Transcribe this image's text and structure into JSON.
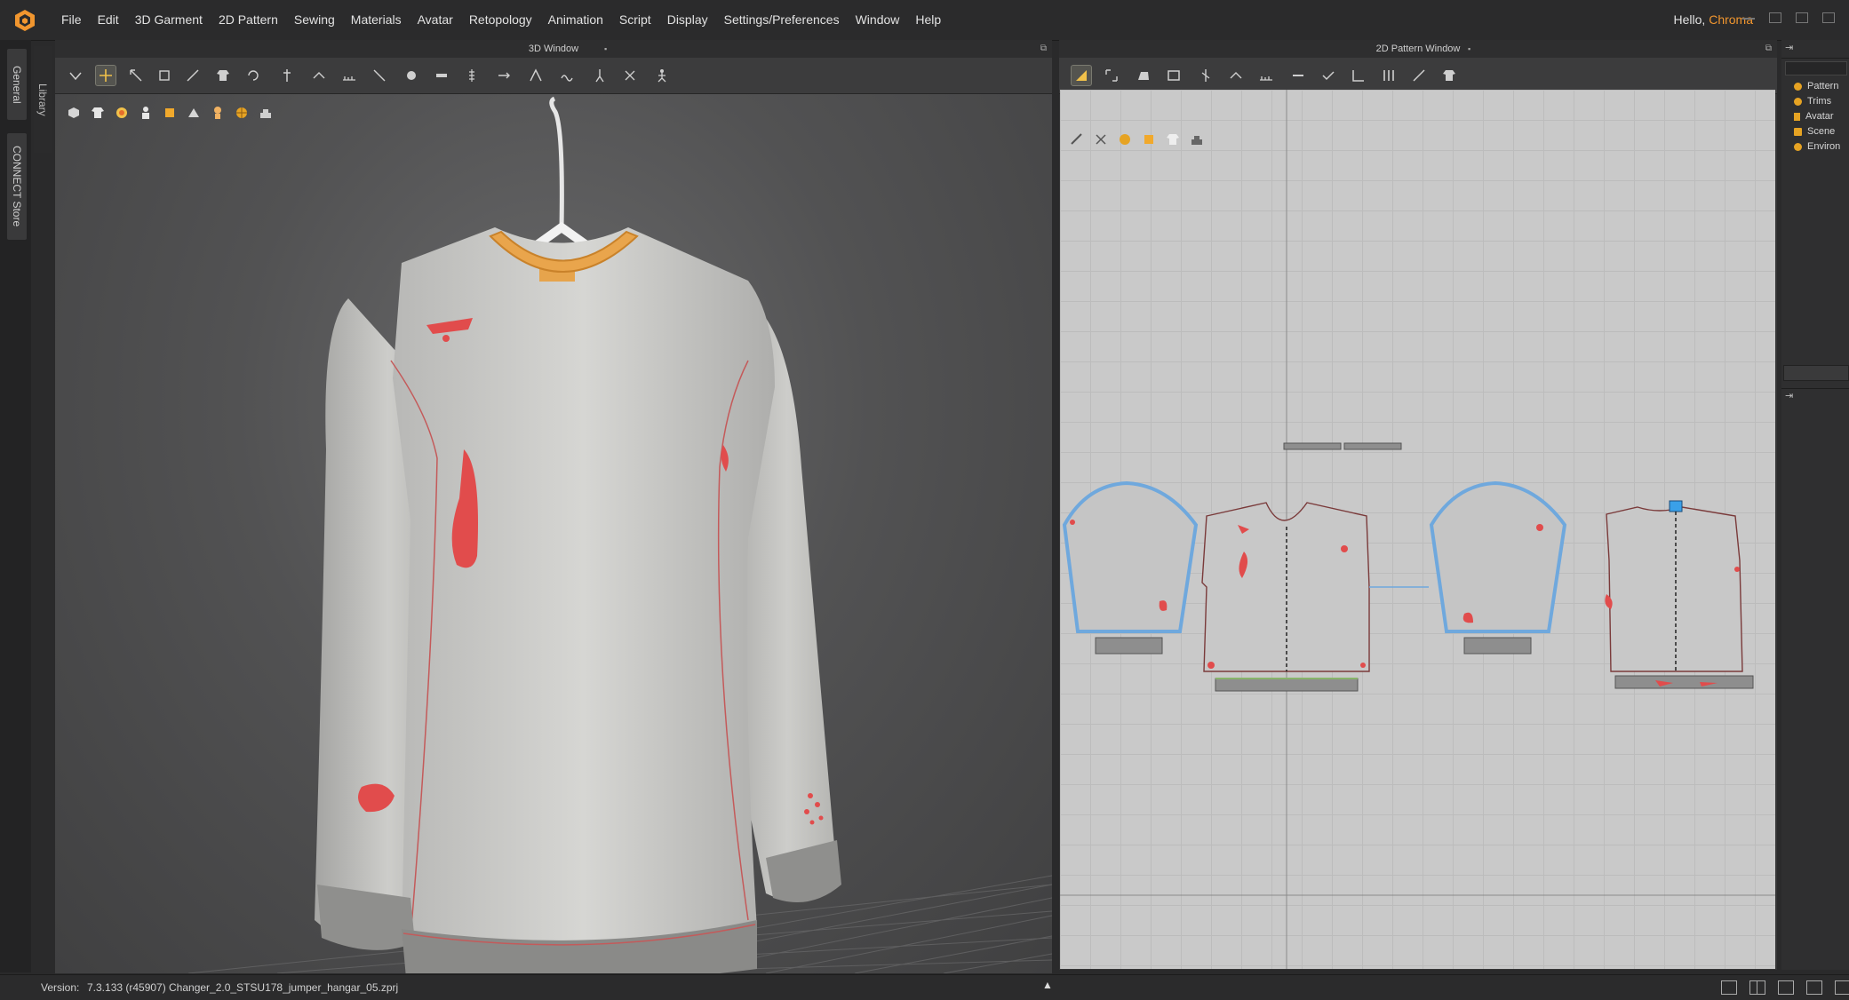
{
  "app": {
    "menu": [
      "File",
      "Edit",
      "3D Garment",
      "2D Pattern",
      "Sewing",
      "Materials",
      "Avatar",
      "Retopology",
      "Animation",
      "Script",
      "Display",
      "Settings/Preferences",
      "Window",
      "Help"
    ],
    "greeting": "Hello,",
    "user_name": "Chroma",
    "accent_color": "#f1962f"
  },
  "side_tabs": {
    "general": "General",
    "library": "Library",
    "connect": "CONNECT Store"
  },
  "window3d": {
    "title": "3D Window"
  },
  "window2d": {
    "title": "2D Pattern Window"
  },
  "object_browser": {
    "items": [
      "Pattern",
      "Trims",
      "Avatar",
      "Scene",
      "Environ"
    ]
  },
  "status": {
    "version_label": "Version:",
    "version": "7.3.133 (r45907)",
    "file": "Changer_2.0_STSU178_jumper_hangar_05.zprj"
  }
}
